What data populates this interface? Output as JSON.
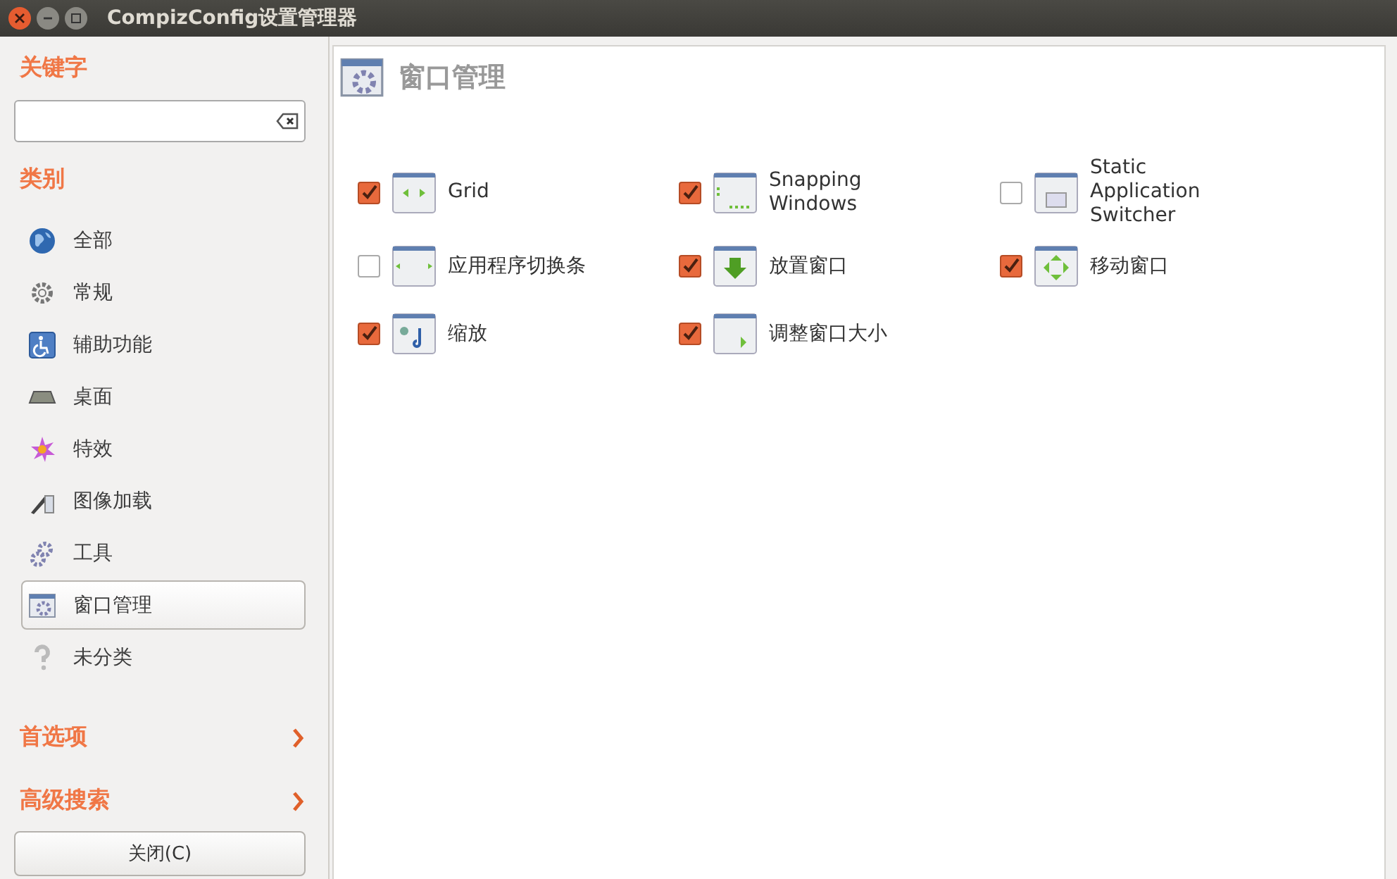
{
  "window": {
    "title": "CompizConfig设置管理器"
  },
  "sidebar": {
    "keyword_heading": "关键字",
    "category_heading": "类别",
    "categories": [
      {
        "label": "全部",
        "selected": false
      },
      {
        "label": "常规",
        "selected": false
      },
      {
        "label": "辅助功能",
        "selected": false
      },
      {
        "label": "桌面",
        "selected": false
      },
      {
        "label": "特效",
        "selected": false
      },
      {
        "label": "图像加载",
        "selected": false
      },
      {
        "label": "工具",
        "selected": false
      },
      {
        "label": "窗口管理",
        "selected": true
      },
      {
        "label": "未分类",
        "selected": false
      }
    ],
    "expanders": [
      {
        "label": "首选项",
        "expanded": false
      },
      {
        "label": "高级搜索",
        "expanded": false
      }
    ],
    "close_button": "关闭(C)"
  },
  "page": {
    "title": "窗口管理",
    "plugins": [
      {
        "label": "Grid",
        "checked": true
      },
      {
        "label": "Snapping Windows",
        "checked": true
      },
      {
        "label": "Static Application Switcher",
        "checked": false
      },
      {
        "label": "应用程序切换条",
        "checked": false
      },
      {
        "label": "放置窗口",
        "checked": true
      },
      {
        "label": "移动窗口",
        "checked": true
      },
      {
        "label": "缩放",
        "checked": true
      },
      {
        "label": "调整窗口大小",
        "checked": true
      }
    ]
  }
}
